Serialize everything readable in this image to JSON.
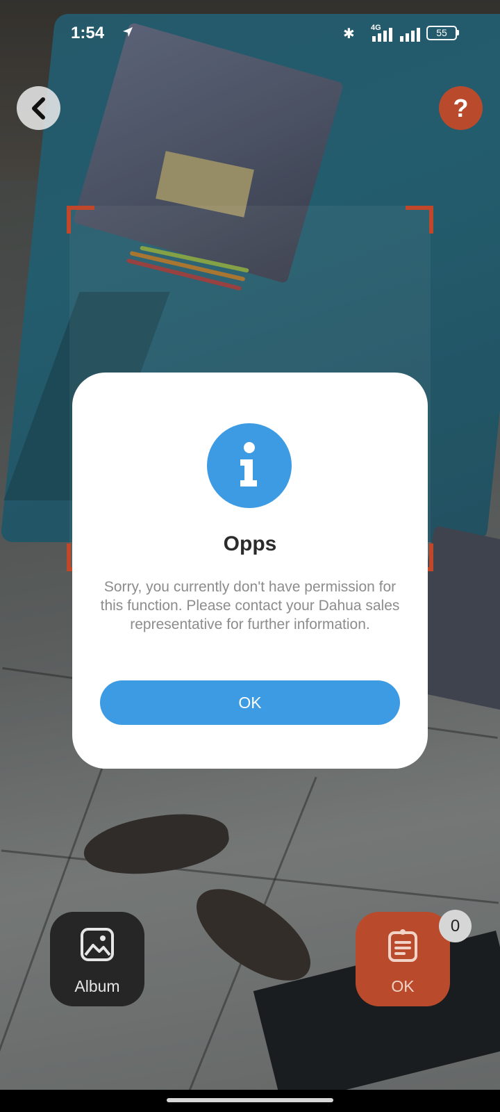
{
  "status_bar": {
    "time": "1:54",
    "battery": "55",
    "network": "4G"
  },
  "header": {
    "back_icon": "chevron-left-icon",
    "help_label": "?"
  },
  "dialog": {
    "icon": "info-icon",
    "icon_color": "#3d9be4",
    "title": "Opps",
    "message": "Sorry, you currently don't have permission for this function. Please contact your Dahua sales representative for further information.",
    "ok_label": "OK"
  },
  "bottom": {
    "album_label": "Album",
    "ok_label": "OK",
    "count": "0"
  },
  "colors": {
    "accent": "#b94a2c",
    "primary": "#3d9be4"
  }
}
